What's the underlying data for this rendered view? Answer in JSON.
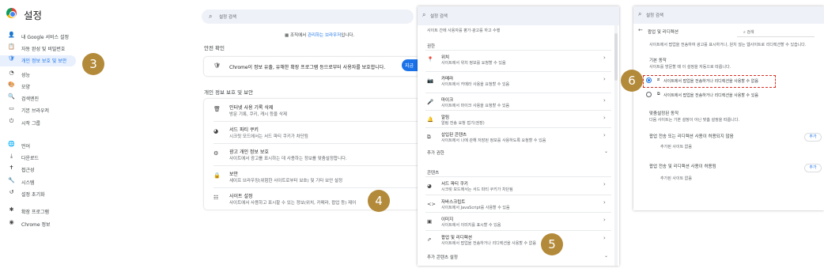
{
  "panel1": {
    "title": "설정",
    "search_placeholder": "설정 검색",
    "sidebar": [
      {
        "icon": "person-icon",
        "glyph": "👤",
        "label": "내 Google 서비스 설정"
      },
      {
        "icon": "clipboard-icon",
        "glyph": "📋",
        "label": "자동 완성 및 비밀번호"
      },
      {
        "icon": "shield-icon",
        "glyph": "🛡",
        "label": "개인 정보 보호 및 보안",
        "active": true
      },
      {
        "icon": "speedometer-icon",
        "glyph": "◔",
        "label": "성능"
      },
      {
        "icon": "palette-icon",
        "glyph": "🎨",
        "label": "모양"
      },
      {
        "icon": "search-icon",
        "glyph": "🔍",
        "label": "검색엔진"
      },
      {
        "icon": "browser-icon",
        "glyph": "▭",
        "label": "기본 브라우저"
      },
      {
        "icon": "power-icon",
        "glyph": "⏻",
        "label": "시작 그룹"
      },
      {
        "icon": "globe-icon",
        "glyph": "🌐",
        "label": "언어"
      },
      {
        "icon": "download-icon",
        "glyph": "⤓",
        "label": "다운로드"
      },
      {
        "icon": "accessibility-icon",
        "glyph": "✝",
        "label": "접근성"
      },
      {
        "icon": "wrench-icon",
        "glyph": "🔧",
        "label": "시스템"
      },
      {
        "icon": "history-icon",
        "glyph": "↺",
        "label": "설정 초기화"
      },
      {
        "icon": "puzzle-icon",
        "glyph": "✱",
        "label": "확장 프로그램"
      },
      {
        "icon": "chrome-icon",
        "glyph": "◉",
        "label": "Chrome 정보"
      }
    ],
    "managed_text": "조직에서 ",
    "managed_link": "관리하는 브라우저",
    "managed_suffix": "입니다.",
    "safety_title": "안전 확인",
    "safety_text": "Chrome이 정보 유출, 유해한 확장 프로그램 등으로부터 사용자를 보호합니다.",
    "go_label": "지금",
    "privacy_title": "개인 정보 보호 및 보안",
    "privacy_rows": [
      {
        "icon": "trash-icon",
        "glyph": "🗑",
        "title": "인터넷 사용 기록 삭제",
        "sub": "방문 기록, 쿠키, 캐시 등을 삭제"
      },
      {
        "icon": "cookie-icon",
        "glyph": "◕",
        "title": "서드 파티 쿠키",
        "sub": "시크릿 모드에서는 서드 파티 쿠키가 차단됨"
      },
      {
        "icon": "ad-privacy-icon",
        "glyph": "⚙",
        "title": "광고 개인 정보 보호",
        "sub": "사이트에서 광고를 표시하는 데 사용하는 정보를 맞춤설정합니다."
      },
      {
        "icon": "security-icon",
        "glyph": "🔒",
        "title": "보안",
        "sub": "세이프 브라우징(위험한 사이트로부터 보호) 및 기타 보안 설정"
      },
      {
        "icon": "sliders-icon",
        "glyph": "☷",
        "title": "사이트 설정",
        "sub": "사이트에서 사용하고 표시할 수 있는 정보(위치, 카메라, 팝업 등) 제어"
      }
    ]
  },
  "panel2": {
    "search_placeholder": "설정 검색",
    "top_sub": "사이트 간에 사용자를 평가·광고를 하고 수행",
    "groups": [
      {
        "label": "권한"
      },
      {
        "label": "추가 권한"
      },
      {
        "label": "콘텐츠"
      },
      {
        "label": "추가 콘텐츠 설정"
      }
    ],
    "rows": [
      {
        "icon": "location-icon",
        "glyph": "📍",
        "title": "위치",
        "sub": "사이트에서 위치 정보를 요청할 수 있음"
      },
      {
        "icon": "camera-icon",
        "glyph": "📷",
        "title": "카메라",
        "sub": "사이트에서 카메라 사용을 요청할 수 있음"
      },
      {
        "icon": "microphone-icon",
        "glyph": "🎤",
        "title": "마이크",
        "sub": "사이트에서 마이크 사용을 요청할 수 있음"
      },
      {
        "icon": "bell-icon",
        "glyph": "🔔",
        "title": "알림",
        "sub": "알림 전송 요청 접기(권장)"
      },
      {
        "icon": "embedded-content-icon",
        "glyph": "⧉",
        "title": "삽입된 콘텐츠",
        "sub": "사이트에서 나에 관해 저장된 정보를 사용하도록 요청할 수 있음"
      },
      {
        "icon": "cookie-icon",
        "glyph": "◕",
        "title": "서드 파티 쿠키",
        "sub": "시크릿 모드에서는 서드 파티 쿠키가 차단됨"
      },
      {
        "icon": "code-icon",
        "glyph": "<>",
        "title": "자바스크립트",
        "sub": "사이트에서 JavaScript를 사용할 수 있음"
      },
      {
        "icon": "image-icon",
        "glyph": "▣",
        "title": "이미지",
        "sub": "사이트에서 이미지를 표시할 수 있음"
      },
      {
        "icon": "popup-icon",
        "glyph": "⇗",
        "title": "팝업 및 리디렉션",
        "sub": "사이트에서 팝업을 전송하거나 리디렉션을 사용할 수 없음"
      }
    ]
  },
  "panel3": {
    "search_placeholder": "설정 검색",
    "back_title": "팝업 및 리디렉션",
    "search_label": "검색",
    "desc": "사이트에서 팝업을 전송하여 광고를 표시하거나, 원치 않는 웹사이트로 리디렉션할 수 있습니다.",
    "default_title": "기본 동작",
    "default_sub": "사이트를 방문할 때 이 설정을 자동으로 따릅니다.",
    "option_block": "사이트에서 팝업을 전송하거나 리디렉션을 사용할 수 없음",
    "option_allow": "사이트에서 팝업을 전송하거나 리디렉션을 사용할 수 있음",
    "custom_title": "맞춤설정된 동작",
    "custom_sub": "다음 사이트는 기본 설정이 아닌 맞춤 설정을 따릅니다.",
    "not_allowed_title": "팝업 전송 또는 리디렉션 사용이 허용되지 않음",
    "not_allowed_empty": "추가된 사이트 없음",
    "allowed_title": "팝업 전송 및 리디렉션 사용이 허용됨",
    "allowed_empty": "추가된 사이트 없음",
    "add_label": "추가"
  },
  "badges": {
    "b3": "3",
    "b4": "4",
    "b5": "5",
    "b6": "6"
  },
  "colors": {
    "accent": "#1a73e8",
    "badge": "#b38a3a",
    "highlight": "#d93025"
  }
}
